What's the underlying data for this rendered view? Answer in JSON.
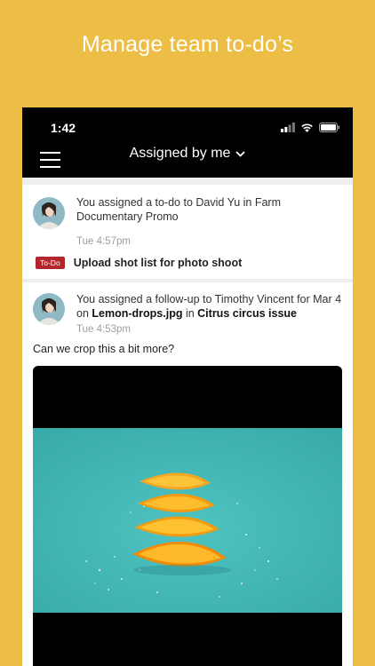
{
  "promo": {
    "title": "Manage team to-do’s"
  },
  "status_bar": {
    "time": "1:42",
    "icons": [
      "signal-icon",
      "wifi-icon",
      "battery-icon"
    ]
  },
  "nav": {
    "title": "Assigned by me",
    "menu_icon": "hamburger-menu-icon",
    "dropdown_icon": "chevron-down-icon"
  },
  "feed": [
    {
      "message_plain": "You assigned a to-do to David Yu in Farm Documentary Promo",
      "timestamp": "Tue 4:57pm",
      "badge": "To-Do",
      "task": "Upload shot list for photo shoot"
    },
    {
      "message_prefix": "You assigned a follow-up to Timothy Vincent for Mar 4 on ",
      "file_name": "Lemon-drops.jpg",
      "message_mid": " in ",
      "project_name": "Citrus circus issue",
      "timestamp": "Tue 4:53pm",
      "comment": "Can we crop this a bit more?"
    }
  ],
  "colors": {
    "background": "#ecbe45",
    "topbar": "#000000",
    "badge": "#b3262b",
    "photo_backdrop": "#43b9b8"
  }
}
